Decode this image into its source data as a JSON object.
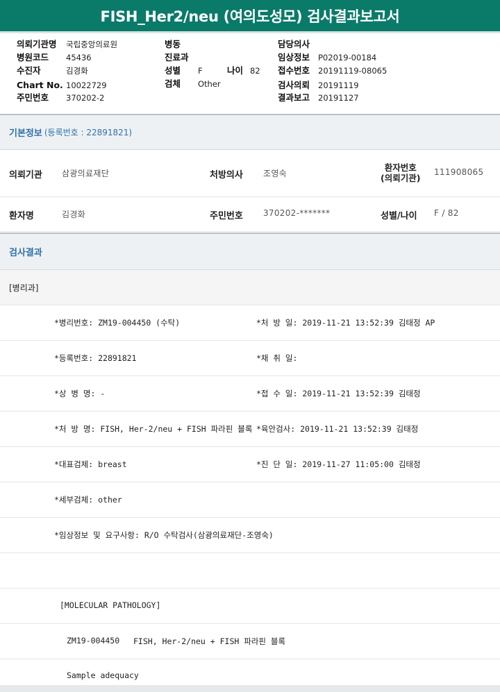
{
  "report": {
    "title": "FISH_Her2/neu (여의도성모) 검사결과보고서"
  },
  "header": {
    "col1": [
      {
        "label": "의뢰기관명",
        "value": "국립중앙의료원"
      },
      {
        "label": "병원코드",
        "value": "45436"
      },
      {
        "label": "수진자",
        "value": "김경화"
      },
      {
        "label": "Chart No.",
        "value": "10022729"
      },
      {
        "label": "주민번호",
        "value": "370202-2"
      }
    ],
    "col2": [
      {
        "label": "병동",
        "value": ""
      },
      {
        "label": "진료과",
        "value": ""
      },
      {
        "label": "성별",
        "value": "F"
      },
      {
        "label": "검체",
        "value": "Other"
      }
    ],
    "age": {
      "label": "나이",
      "value": "82"
    },
    "col3": [
      {
        "label": "담당의사",
        "value": ""
      },
      {
        "label": "임상정보",
        "value": "P02019-00184"
      },
      {
        "label": "접수번호",
        "value": "20191119-08065"
      },
      {
        "label": "검사의뢰",
        "value": "20191119"
      },
      {
        "label": "결과보고",
        "value": "20191127"
      }
    ]
  },
  "basic": {
    "title": "기본정보",
    "subtitle": "(등록번호 : 22891821)",
    "row1": {
      "org_label": "의뢰기관",
      "org_value": "삼광의료재단",
      "doctor_label": "처방의사",
      "doctor_value": "조영숙",
      "patno_label_1": "환자번호",
      "patno_label_2": "(의뢰기관)",
      "patno_value": "111908065"
    },
    "row2": {
      "name_label": "환자명",
      "name_value": "김경화",
      "rrn_label": "주민번호",
      "rrn_value": "370202-*******",
      "sexage_label": "성별/나이",
      "sexage_value": "F / 82"
    }
  },
  "results": {
    "title": "검사결과",
    "dept": "[병리과]",
    "lines": [
      {
        "left": "*병리번호: ZM19-004450 (수탁)",
        "right": "*처 방 일: 2019-11-21 13:52:39  김태정 AP"
      },
      {
        "left": "*등록번호: 22891821",
        "right": "*채 취 일:"
      },
      {
        "left": "*상 병 명: -",
        "right": "*접 수 일: 2019-11-21 13:52:39  김태정"
      },
      {
        "left": "*처 방 명: FISH, Her-2/neu + FISH 파라핀 블록",
        "right": "*육안검사: 2019-11-21 13:52:39  김태정"
      },
      {
        "left": "*대표검체: breast",
        "right": "*진 단 일: 2019-11-27 11:05:00  김태정"
      },
      {
        "left": "*세부검체: other",
        "right": ""
      },
      {
        "left": "*임상정보 및 요구사항: R/O 수탁검사(삼광의료재단-조영숙)",
        "right": ""
      }
    ],
    "mol_header": "[MOLECULAR PATHOLOGY]",
    "mol_code": "ZM19-004450",
    "mol_test": "FISH, Her-2/neu + FISH 파라핀 블록",
    "sample": "Sample adequacy"
  }
}
